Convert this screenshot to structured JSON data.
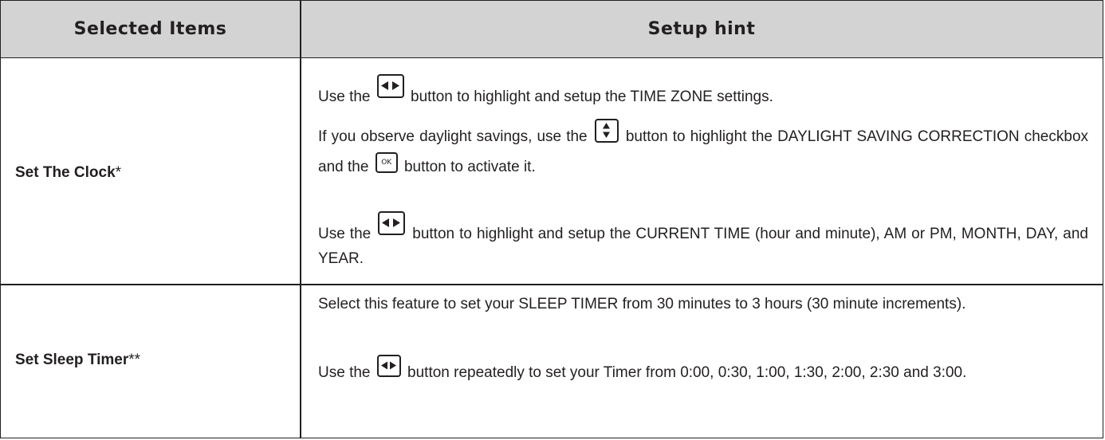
{
  "headers": {
    "selected_items": "Selected Items",
    "setup_hint": "Setup hint"
  },
  "rows": [
    {
      "item_name": "Set The Clock",
      "item_suffix": "*",
      "hints": {
        "p1_before": "Use the",
        "p1_after": "button to highlight and setup the TIME ZONE settings.",
        "p2_before": "If you observe daylight savings, use the",
        "p2_middle": "button to highlight the DAYLIGHT SAVING CORRECTION checkbox and the",
        "p2_after": "button to activate it.",
        "p3_before": "Use the",
        "p3_after": "button to highlight and setup the CURRENT TIME (hour and minute), AM or PM, MONTH, DAY, and YEAR."
      }
    },
    {
      "item_name": "Set Sleep Timer",
      "item_suffix": "**",
      "hints": {
        "p1": "Select this feature to set your SLEEP TIMER from 30 minutes to 3 hours (30 minute increments).",
        "p2_before": "Use the",
        "p2_after": "button repeatedly to set your Timer from 0:00, 0:30, 1:00, 1:30, 2:00, 2:30 and 3:00."
      }
    }
  ],
  "keys": {
    "ok_label": "OK",
    "left_right_icon": "left-right-arrow-button-icon",
    "up_down_icon": "up-down-arrow-button-icon",
    "ok_icon": "ok-button-icon"
  },
  "colors": {
    "header_bg": "#d3d3d3",
    "text": "#231f20",
    "border": "#231f20"
  }
}
